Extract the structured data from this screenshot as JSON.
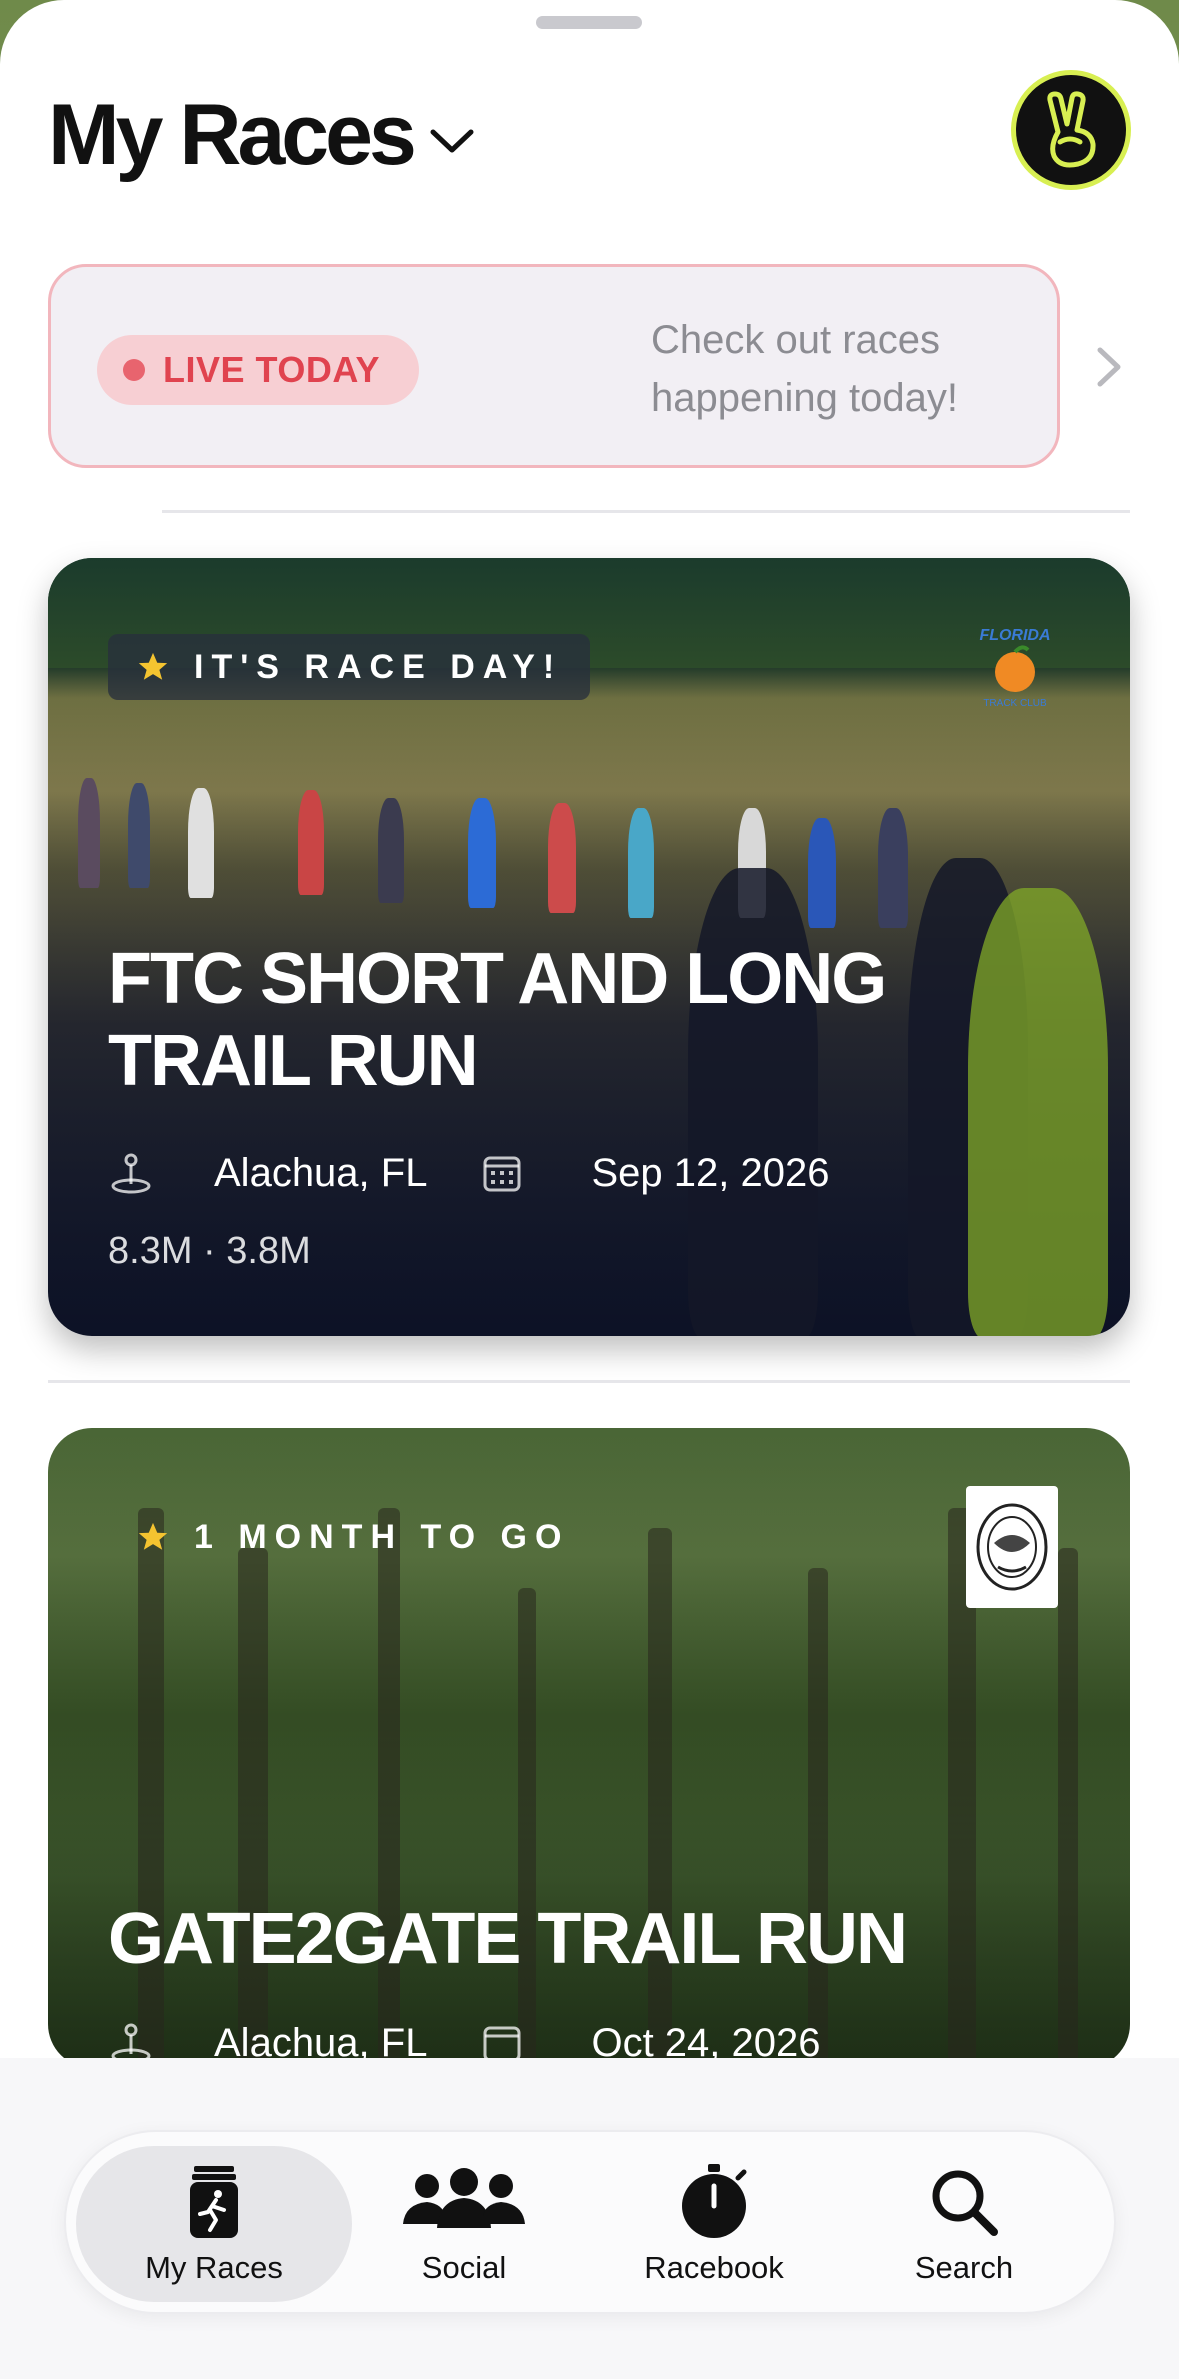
{
  "header": {
    "title": "My Races",
    "avatar_icon": "peace-hand-icon",
    "accent": "#d8ef52"
  },
  "live_banner": {
    "pill_label": "LIVE TODAY",
    "description": "Check out races happening today!",
    "color": "#e0434f"
  },
  "races": [
    {
      "badge": "IT'S RACE DAY!",
      "title_line1": "FTC SHORT AND LONG",
      "title_line2": "TRAIL RUN",
      "location": "Alachua, FL",
      "date": "Sep 12, 2026",
      "distances": "8.3M · 3.8M",
      "logo_icon": "florida-orange-logo-icon"
    },
    {
      "badge": "1 MONTH TO GO",
      "title": "GATE2GATE TRAIL RUN",
      "location": "Alachua, FL",
      "date": "Oct 24, 2026",
      "logo_icon": "race-seal-logo-icon"
    }
  ],
  "tabbar": {
    "tabs": [
      {
        "label": "My Races",
        "icon": "runner-bib-icon",
        "active": true
      },
      {
        "label": "Social",
        "icon": "people-group-icon",
        "active": false
      },
      {
        "label": "Racebook",
        "icon": "stopwatch-icon",
        "active": false
      },
      {
        "label": "Search",
        "icon": "search-icon",
        "active": false
      }
    ]
  }
}
